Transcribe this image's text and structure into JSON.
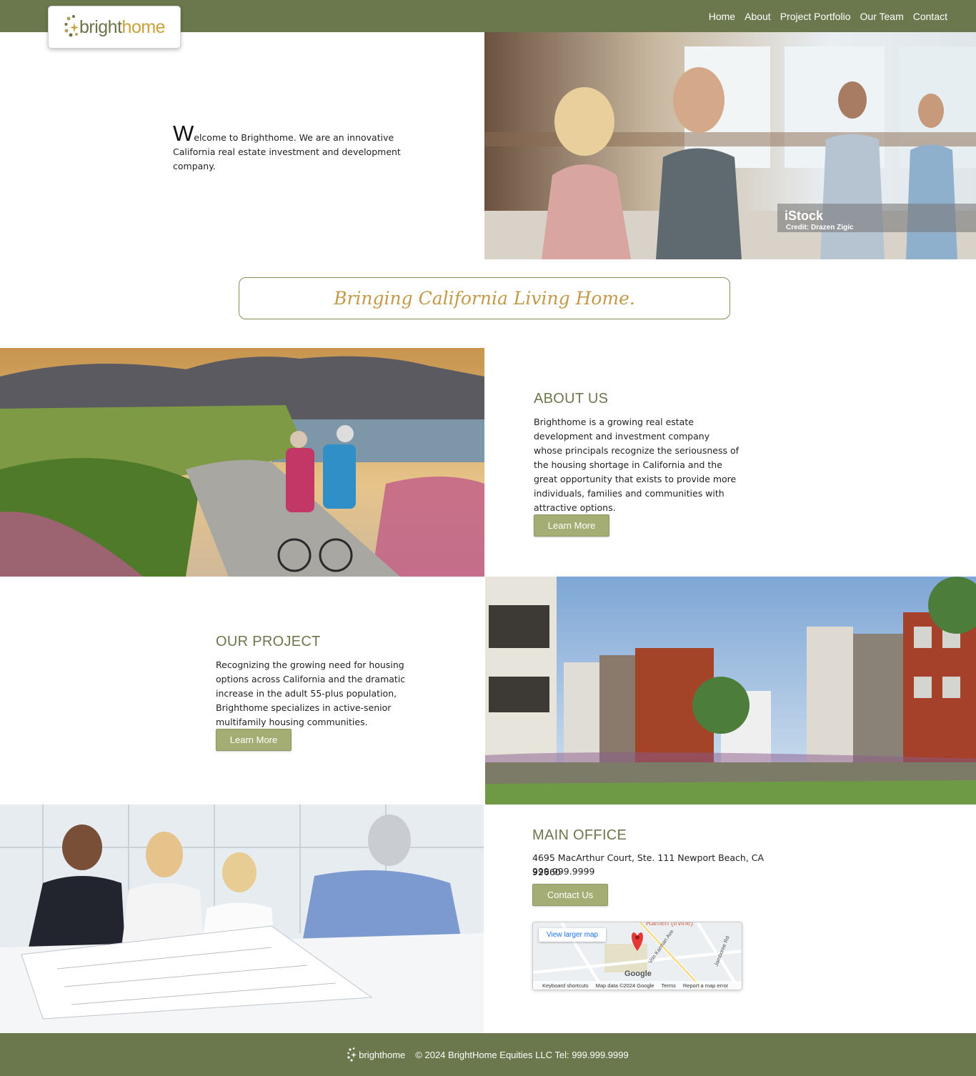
{
  "header": {
    "logo_bright": "bright",
    "logo_home": "home",
    "nav": [
      "Home",
      "About",
      "Project Portfolio",
      "Our Team",
      "Contact"
    ]
  },
  "hero": {
    "dropcap": "W",
    "text": "elcome to Brighthome. We are an innovative California real estate investment and development company.",
    "image_watermark": "iStock",
    "image_credit": "Credit: Drazen Zigic"
  },
  "tagline": "Bringing California Living Home.",
  "about": {
    "title": "ABOUT US",
    "body": "Brighthome is a growing real estate development and investment company whose principals recognize the seriousness of the housing shortage in California and the great opportunity that exists to provide more individuals, families and communities with attractive options.",
    "button": "Learn More"
  },
  "project": {
    "title": "OUR PROJECT",
    "body": "Recognizing the growing need for housing options across California and the dramatic increase in the adult 55-plus population, Brighthome specializes in active-senior multifamily housing communities.",
    "button": "Learn More"
  },
  "office": {
    "title": "MAIN OFFICE",
    "address": "4695 MacArthur Court, Ste. 111 Newport Beach, CA 92660",
    "phone": "999.999.9999",
    "button": "Contact Us"
  },
  "map": {
    "link": "View larger map",
    "label_top": "Ramen (Irvine)",
    "google": "Google",
    "street1": "Von Karman Ave",
    "street2": "Jamboree Rd",
    "footer": [
      "Keyboard shortcuts",
      "Map data ©2024 Google",
      "Terms",
      "Report a map error"
    ]
  },
  "footer": {
    "logo": "brighthome",
    "text": "© 2024 BrightHome Equities LLC Tel: 999.999.9999"
  },
  "colors": {
    "olive": "#6b784d",
    "button": "#a4ad74",
    "gold": "#c39a4a"
  }
}
